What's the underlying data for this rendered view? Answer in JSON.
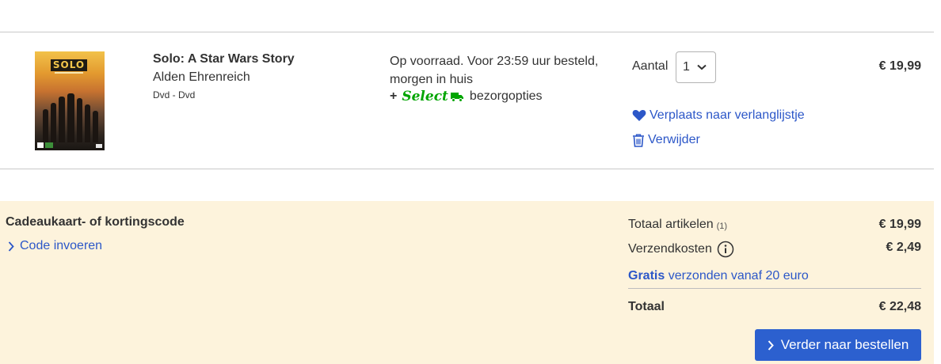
{
  "product": {
    "cover_logo": "SOLO",
    "title": "Solo: A Star Wars Story",
    "artist": "Alden Ehrenreich",
    "format": "Dvd - Dvd",
    "stock_text": "Op voorraad. Voor 23:59 uur besteld, morgen in huis",
    "select_plus": "+",
    "select_brand": "Select",
    "select_suffix": "bezorgopties",
    "quantity_label": "Aantal",
    "quantity_value": "1",
    "price": "€ 19,99",
    "wishlist_label": "Verplaats naar verlanglijstje",
    "remove_label": "Verwijder"
  },
  "coupon": {
    "title": "Cadeaukaart- of kortingscode",
    "link_label": "Code invoeren"
  },
  "summary": {
    "items_label": "Totaal artikelen",
    "items_count": "(1)",
    "items_value": "€ 19,99",
    "shipping_label": "Verzendkosten",
    "shipping_value": "€ 2,49",
    "free_bold": "Gratis",
    "free_rest": "verzonden vanaf 20 euro",
    "total_label": "Totaal",
    "total_value": "€ 22,48"
  },
  "checkout_label": "Verder naar bestellen",
  "icons": {
    "heart": "heart-icon",
    "trash": "trash-icon",
    "chevron": "chevron-right-icon",
    "info": "info-icon",
    "truck": "truck-icon",
    "dropdown": "chevron-down-icon"
  },
  "colors": {
    "link": "#2c57c8",
    "button": "#2c60cf",
    "summary_bg": "#fdf3dc",
    "select_green": "#00a500"
  }
}
